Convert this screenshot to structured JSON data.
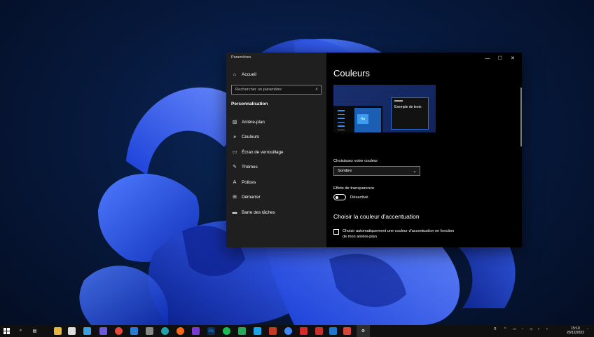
{
  "window": {
    "title": "Paramètres",
    "controls": [
      "—",
      "☐",
      "✕"
    ]
  },
  "sidebar": {
    "home_label": "Accueil",
    "search_placeholder": "Rechercher un paramètre",
    "section_title": "Personnalisation",
    "items": [
      {
        "icon": "image-icon",
        "label": "Arrière-plan"
      },
      {
        "icon": "palette-icon",
        "label": "Couleurs"
      },
      {
        "icon": "lockscreen-icon",
        "label": "Écran de verrouillage"
      },
      {
        "icon": "brush-icon",
        "label": "Thèmes"
      },
      {
        "icon": "fonts-icon",
        "label": "Polices"
      },
      {
        "icon": "start-icon",
        "label": "Démarrer"
      },
      {
        "icon": "taskbar-icon",
        "label": "Barre des tâches"
      }
    ]
  },
  "content": {
    "title": "Couleurs",
    "preview_text": "Exemple de texte",
    "preview_tile": "Aa",
    "choose_color_label": "Choisissez votre couleur",
    "choose_color_value": "Sombre",
    "transparency_label": "Effets de transparence",
    "transparency_state": "Désactivé",
    "transparency_on": false,
    "accent_heading": "Choisir la couleur d'accentuation",
    "auto_accent_line1": "Choisir automatiquement une couleur d'accentuation en fonction",
    "auto_accent_line2": "de mon arrière-plan",
    "auto_accent_checked": false
  },
  "taskbar": {
    "tray_lang": "R",
    "time": "15:10",
    "date": "20/12/2022"
  },
  "colors": {
    "accent": "#2f6ed1",
    "sidebar_bg": "#1f1f1f",
    "content_bg": "#000000"
  }
}
